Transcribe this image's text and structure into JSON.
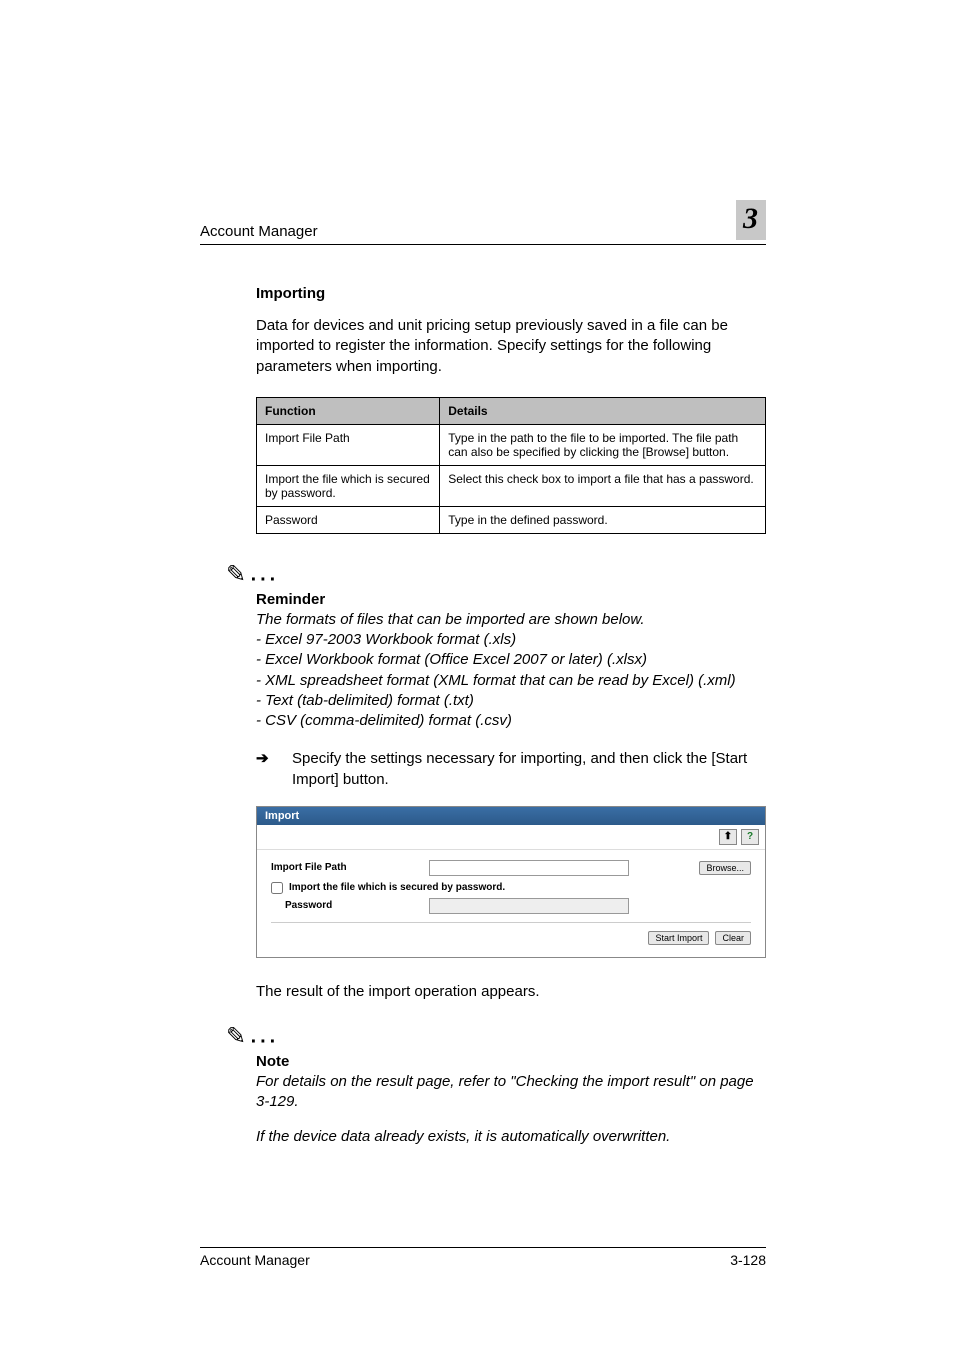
{
  "header": {
    "section": "Account Manager",
    "chapter": "3"
  },
  "section": {
    "title": "Importing",
    "intro": "Data for devices and unit pricing setup previously saved in a file can be imported to register the information. Specify settings for the following parameters when importing."
  },
  "table": {
    "head": {
      "c1": "Function",
      "c2": "Details"
    },
    "rows": [
      {
        "c1": "Import File Path",
        "c2": "Type in the path to the file to be imported. The file path can also be specified by clicking the [Browse] button."
      },
      {
        "c1": "Import the file which is secured by password.",
        "c2": "Select this check box to import a file that has a password."
      },
      {
        "c1": "Password",
        "c2": "Type in the defined password."
      }
    ]
  },
  "reminder": {
    "title": "Reminder",
    "lines": [
      "The formats of files that can be imported are shown below.",
      "- Excel 97-2003 Workbook format (.xls)",
      "- Excel Workbook format (Office Excel 2007 or later) (.xlsx)",
      "- XML spreadsheet format (XML format that can be read by Excel) (.xml)",
      "- Text (tab-delimited) format (.txt)",
      "- CSV (comma-delimited) format (.csv)"
    ]
  },
  "step": {
    "arrow": "➔",
    "text": "Specify the settings necessary for importing, and then click the [Start Import] button."
  },
  "dialog": {
    "title": "Import",
    "toolbar": {
      "up": "⬆",
      "help": "?"
    },
    "fields": {
      "path_label": "Import File Path",
      "browse": "Browse...",
      "check_label": "Import the file which is secured by password.",
      "password_label": "Password"
    },
    "actions": {
      "start": "Start Import",
      "clear": "Clear"
    }
  },
  "post_step": "The result of the import operation appears.",
  "note": {
    "title": "Note",
    "p1": "For details on the result page, refer to \"Checking the import result\" on page 3-129.",
    "p2": "If the device data already exists, it is automatically overwritten."
  },
  "footer": {
    "left": "Account Manager",
    "right": "3-128"
  }
}
